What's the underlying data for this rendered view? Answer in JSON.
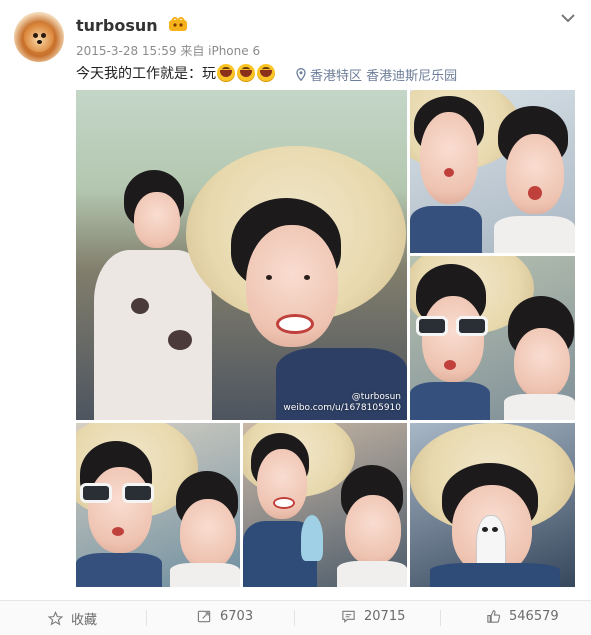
{
  "post": {
    "username": "turbosun",
    "meta": "2015-3-28 15:59 来自 iPhone 6",
    "text": "今天我的工作就是：玩",
    "emojis": [
      "laugh-emoji",
      "laugh-emoji",
      "laugh-emoji"
    ],
    "location": "香港特区 香港迪斯尼乐园",
    "watermark": "@turbosun\nweibo.com/u/1678105910"
  },
  "actions": [
    {
      "icon": "star-icon",
      "label": "收藏"
    },
    {
      "icon": "repost-icon",
      "label": "6703"
    },
    {
      "icon": "comment-icon",
      "label": "20715"
    },
    {
      "icon": "like-icon",
      "label": "546579"
    }
  ],
  "colors": {
    "username": "#333333",
    "meta": "#8c8c8c",
    "location": "#6d7e99",
    "action_text": "#6b6b6b"
  }
}
